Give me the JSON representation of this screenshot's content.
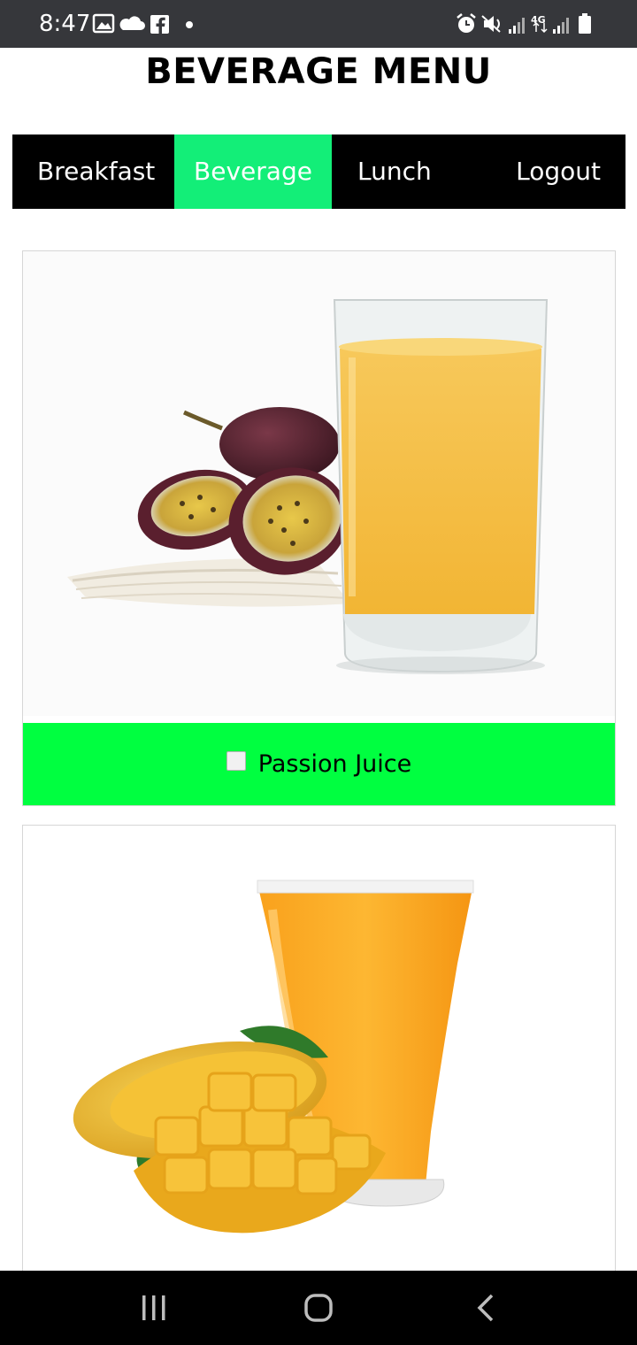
{
  "status_bar": {
    "time": "8:47",
    "background": "#36373b",
    "left_icons": [
      "image-icon",
      "cloud-icon",
      "facebook-icon",
      "dot-icon"
    ],
    "right_icons": [
      "alarm-icon",
      "mute-icon",
      "signal-icon",
      "4g-icon",
      "signal-icon",
      "battery-icon"
    ],
    "network_label": "4G"
  },
  "page": {
    "title": "BEVERAGE MENU"
  },
  "nav": {
    "items": [
      {
        "label": "Breakfast",
        "active": false
      },
      {
        "label": "Beverage",
        "active": true
      },
      {
        "label": "Lunch",
        "active": false
      },
      {
        "label": "Logout",
        "active": false
      }
    ],
    "background": "#000000",
    "active_color": "#13ee78"
  },
  "menu_items": [
    {
      "name": "Passion Juice",
      "checked": false,
      "image": "passion-juice-image",
      "footer_color": "#00ff40"
    },
    {
      "name": "",
      "checked": false,
      "image": "mango-juice-image"
    }
  ],
  "system_nav": {
    "buttons": [
      "recent-apps-icon",
      "home-icon",
      "back-icon"
    ]
  }
}
